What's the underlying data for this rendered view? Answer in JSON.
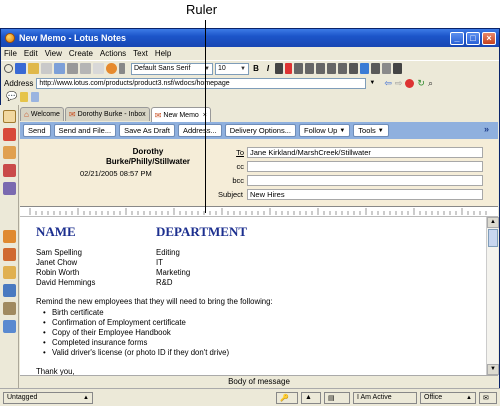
{
  "callout": {
    "label": "Ruler"
  },
  "window": {
    "title": "New Memo - Lotus Notes"
  },
  "menu": [
    "File",
    "Edit",
    "View",
    "Create",
    "Actions",
    "Text",
    "Help"
  ],
  "toolbar": {
    "font_family": "Default Sans Serif",
    "font_size": "10",
    "bold": "B",
    "italic": "I"
  },
  "address": {
    "label": "Address",
    "url": "http://www.lotus.com/products/product3.nsf/wdocs/homepage"
  },
  "tabs": [
    {
      "label": "Welcome"
    },
    {
      "label": "Dorothy Burke - Inbox"
    },
    {
      "label": "New Memo"
    }
  ],
  "actions": [
    {
      "label": "Send"
    },
    {
      "label": "Send and File..."
    },
    {
      "label": "Save As Draft"
    },
    {
      "label": "Address..."
    },
    {
      "label": "Delivery Options..."
    },
    {
      "label": "Follow Up"
    },
    {
      "label": "Tools"
    }
  ],
  "header": {
    "sender": "Dorothy Burke/Philly/Stillwater",
    "date": "02/21/2005 08:57 PM",
    "to_label": "To",
    "to_value": "Jane Kirkland/MarshCreek/Stillwater",
    "cc_label": "cc",
    "cc_value": "",
    "bcc_label": "bcc",
    "bcc_value": "",
    "subject_label": "Subject",
    "subject_value": "New Hires"
  },
  "body": {
    "col1": "NAME",
    "col2": "DEPARTMENT",
    "people": [
      {
        "name": "Sam Spelling",
        "dept": "Editing"
      },
      {
        "name": "Janet Chow",
        "dept": "IT"
      },
      {
        "name": "Robin Worth",
        "dept": "Marketing"
      },
      {
        "name": "David Hemmings",
        "dept": "R&D"
      }
    ],
    "intro": "Remind the new employees that they will need to bring the following:",
    "bullets": [
      "Birth certificate",
      "Confirmation of Employment certificate",
      "Copy of their Employee Handbook",
      "Completed insurance forms",
      "Valid driver's license (or photo ID if they don't drive)"
    ],
    "closing": "Thank you,"
  },
  "body_label": "Body of message",
  "status": {
    "untagged": "Untagged",
    "active": "I Am Active",
    "location": "Office"
  }
}
